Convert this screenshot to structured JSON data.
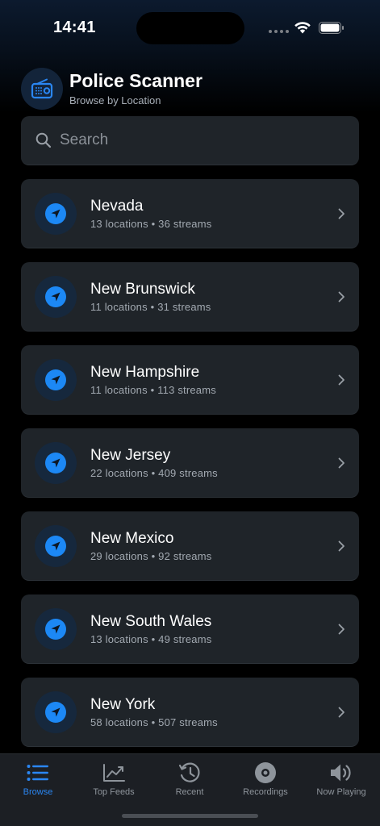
{
  "status_bar": {
    "time": "14:41",
    "wifi_icon": "wifi-icon",
    "battery_icon": "battery-icon"
  },
  "header": {
    "title": "Police Scanner",
    "subtitle": "Browse by Location",
    "icon": "radio-icon"
  },
  "search": {
    "placeholder": "Search",
    "value": "",
    "icon": "search-icon"
  },
  "locations": [
    {
      "name": "Nevada",
      "meta": "13 locations • 36 streams"
    },
    {
      "name": "New Brunswick",
      "meta": "11 locations • 31 streams"
    },
    {
      "name": "New Hampshire",
      "meta": "11 locations • 113 streams"
    },
    {
      "name": "New Jersey",
      "meta": "22 locations • 409 streams"
    },
    {
      "name": "New Mexico",
      "meta": "29 locations • 92 streams"
    },
    {
      "name": "New South Wales",
      "meta": "13 locations • 49 streams"
    },
    {
      "name": "New York",
      "meta": "58 locations • 507 streams"
    }
  ],
  "tabbar": {
    "items": [
      {
        "label": "Browse",
        "icon": "list-icon",
        "active": true
      },
      {
        "label": "Top Feeds",
        "icon": "trending-chart-icon",
        "active": false
      },
      {
        "label": "Recent",
        "icon": "history-clock-icon",
        "active": false
      },
      {
        "label": "Recordings",
        "icon": "record-disc-icon",
        "active": false
      },
      {
        "label": "Now Playing",
        "icon": "speaker-icon",
        "active": false
      }
    ]
  },
  "colors": {
    "accent": "#1c88f5",
    "card": "#1f2429",
    "tab_active": "#2a86f2",
    "tab_inactive": "#8e949b"
  }
}
